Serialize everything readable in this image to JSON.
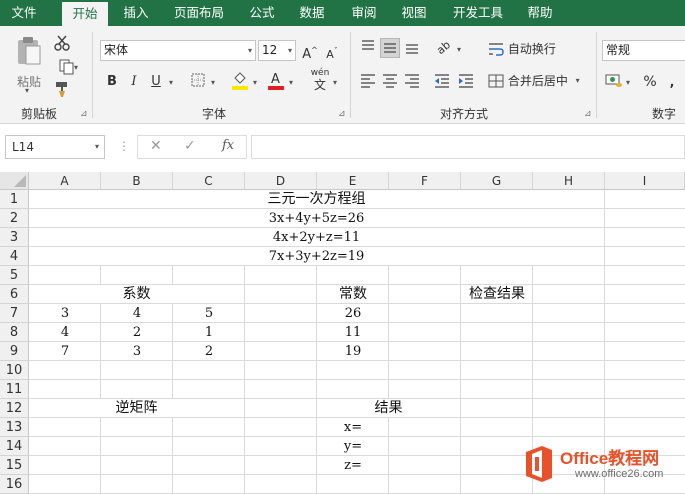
{
  "tabs": [
    {
      "id": "file",
      "label": "文件"
    },
    {
      "id": "home",
      "label": "开始",
      "active": true
    },
    {
      "id": "insert",
      "label": "插入"
    },
    {
      "id": "layout",
      "label": "页面布局"
    },
    {
      "id": "formulas",
      "label": "公式"
    },
    {
      "id": "data",
      "label": "数据"
    },
    {
      "id": "review",
      "label": "审阅"
    },
    {
      "id": "view",
      "label": "视图"
    },
    {
      "id": "developer",
      "label": "开发工具"
    },
    {
      "id": "help",
      "label": "帮助"
    }
  ],
  "ribbon": {
    "clipboard": {
      "label": "剪贴板",
      "paste_label": "粘贴"
    },
    "font": {
      "label": "字体",
      "name": "宋体",
      "size": "12",
      "bold": "B",
      "italic": "I",
      "underline": "U",
      "phonetic": "wén",
      "phonetic_sub": "文"
    },
    "alignment": {
      "label": "对齐方式",
      "wrap_text": "自动换行",
      "merge_center": "合并后居中"
    },
    "number": {
      "label": "数字",
      "format": "常规",
      "percent": "%"
    }
  },
  "formula_bar": {
    "name_box": "L14",
    "fx": "fx",
    "content": ""
  },
  "columns": [
    "A",
    "B",
    "C",
    "D",
    "E",
    "F",
    "G",
    "H",
    "I"
  ],
  "rows": [
    "1",
    "2",
    "3",
    "4",
    "5",
    "6",
    "7",
    "8",
    "9",
    "10",
    "11",
    "12",
    "13",
    "14",
    "15",
    "16"
  ],
  "sheet": {
    "title": "三元一次方程组",
    "eq1": "3x+4y+5z=26",
    "eq2": "4x+2y+z=11",
    "eq3": "7x+3y+2z=19",
    "coef_header": "系数",
    "const_header": "常数",
    "check_header": "检查结果",
    "coef_rows": [
      [
        "3",
        "4",
        "5"
      ],
      [
        "4",
        "2",
        "1"
      ],
      [
        "7",
        "3",
        "2"
      ]
    ],
    "constants": [
      "26",
      "11",
      "19"
    ],
    "inverse_header": "逆矩阵",
    "result_header": "结果",
    "result_labels": [
      "x=",
      "y=",
      "z="
    ]
  },
  "watermark": {
    "brand": "Office教程网",
    "url": "www.office26.com"
  },
  "colors": {
    "accent": "#217346",
    "watermark": "#e8512a"
  }
}
